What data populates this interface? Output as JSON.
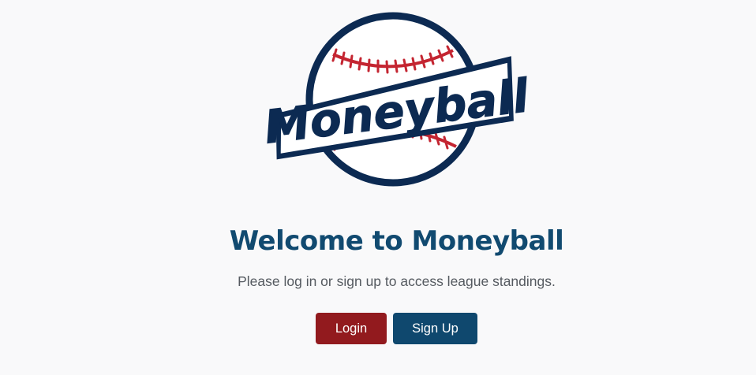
{
  "logo": {
    "wordmark": "Moneyball",
    "colors": {
      "navy": "#0c2a52",
      "stitch_red": "#c42531",
      "ball_white": "#ffffff"
    }
  },
  "hero": {
    "title": "Welcome to Moneyball",
    "subtitle": "Please log in or sign up to access league standings."
  },
  "actions": {
    "login_label": "Login",
    "signup_label": "Sign Up"
  },
  "colors": {
    "title": "#114a70",
    "login_button": "#921a1e",
    "signup_button": "#0f486e",
    "background": "#f9f9fa"
  }
}
